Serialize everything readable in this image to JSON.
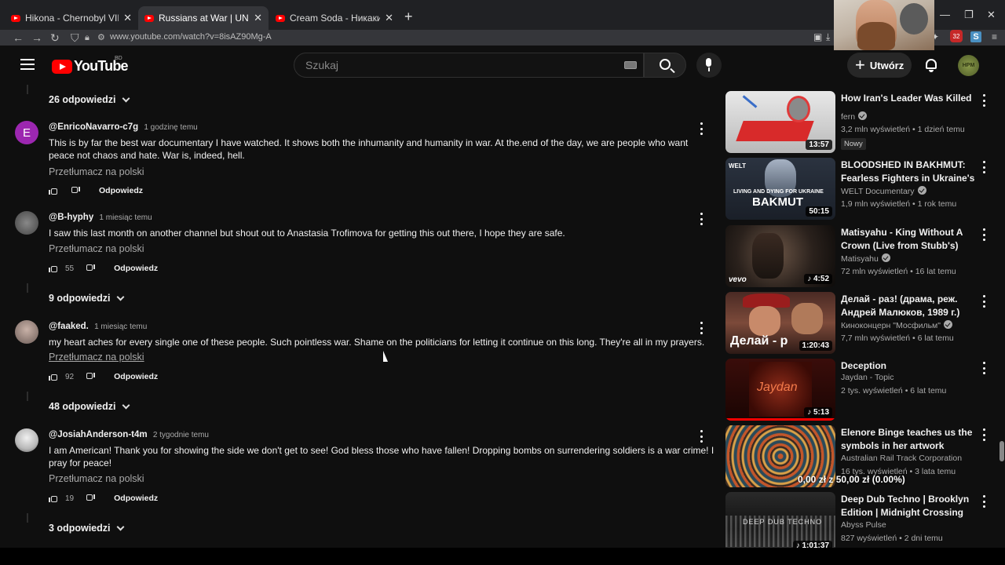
{
  "browser": {
    "tabs": [
      {
        "title": "Hikona - Chernobyl VIP - YouTube",
        "active": false
      },
      {
        "title": "Russians at War | UNCENSORED",
        "active": true
      },
      {
        "title": "Cream Soda - Никаких бол",
        "active": false
      }
    ],
    "new_tab_icon": "+",
    "url": "www.youtube.com/watch?v=8isAZ90Mg-A",
    "ext_badge": "32"
  },
  "header": {
    "logo_text": "YouTube",
    "country_code": "BD",
    "search_placeholder": "Szukaj",
    "create_label": "Utwórz",
    "avatar_text": "HPM"
  },
  "comments": {
    "top_replies": "26 odpowiedzi",
    "items": [
      {
        "author": "@EnricoNavarro-c7g",
        "time": "1 godzinę temu",
        "avatar_letter": "E",
        "avatar_color": "#9c27b0",
        "text": "This is by far the best war documentary I have watched. It shows both the inhumanity and humanity in war. At the.end of the day, we are people who want peace not chaos and hate. War is, indeed, hell.",
        "translate": "Przetłumacz na polski",
        "likes": "",
        "reply": "Odpowiedz",
        "replies": ""
      },
      {
        "author": "@B-hyphy",
        "time": "1 miesiąc temu",
        "avatar_letter": "",
        "avatar_color": "#6b6b6b",
        "text": "I saw this last month on another channel but shout out to Anastasia Trofimova for getting this out there, I hope they are safe.",
        "translate": "Przetłumacz na polski",
        "likes": "55",
        "reply": "Odpowiedz",
        "replies": "9 odpowiedzi"
      },
      {
        "author": "@faaked.",
        "time": "1 miesiąc temu",
        "avatar_letter": "",
        "avatar_color": "#9a8a86",
        "text": "my heart aches for every single one of these people. Such  pointless war. Shame on the politicians for letting it continue on this long. They're all in my prayers.",
        "translate": "Przetłumacz na polski",
        "likes": "92",
        "reply": "Odpowiedz",
        "replies": "48 odpowiedzi"
      },
      {
        "author": "@JosiahAnderson-t4m",
        "time": "2 tygodnie temu",
        "avatar_letter": "",
        "avatar_color": "#d6d6d6",
        "text": "I am American! Thank you for showing the side we don't get to see! God bless those who have fallen! Dropping bombs on surrendering soldiers is a war crime! I pray for peace!",
        "translate": "Przetłumacz na polski",
        "likes": "19",
        "reply": "Odpowiedz",
        "replies": "3 odpowiedzi"
      }
    ]
  },
  "sidebar": {
    "videos": [
      {
        "title": "How Iran's Leader Was Killed",
        "channel": "fern",
        "verified": true,
        "meta": "3,2 mln wyświetleń • 1 dzień temu",
        "duration": "13:57",
        "badge": "Nowy",
        "music": false
      },
      {
        "title": "BLOODSHED IN BAKHMUT: Fearless Fighters in Ukraine's ...",
        "channel": "WELT Documentary",
        "verified": true,
        "meta": "1,9 mln wyświetleń • 1 rok temu",
        "duration": "50:15",
        "badge": "",
        "music": false,
        "thumb_top": "WELT",
        "thumb_sub": "LIVING AND DYING FOR UKRAINE",
        "thumb_big": "BAKMUT"
      },
      {
        "title": "Matisyahu - King Without A Crown (Live from Stubb's)",
        "channel": "Matisyahu",
        "verified": true,
        "meta": "72 mln wyświetleń • 16 lat temu",
        "duration": "4:52",
        "badge": "",
        "music": true,
        "thumb_top": "vevo"
      },
      {
        "title": "Делай - раз! (драма, реж. Андрей Малюков, 1989 г.)",
        "channel": "Киноконцерн \"Мосфильм\"",
        "verified": true,
        "meta": "7,7 mln wyświetleń • 6 lat temu",
        "duration": "1:20:43",
        "badge": "",
        "music": false,
        "thumb_big": "Делай - р"
      },
      {
        "title": "Deception",
        "channel": "Jaydan - Topic",
        "verified": false,
        "meta": "2 tys. wyświetleń • 6 lat temu",
        "duration": "5:13",
        "badge": "",
        "music": true,
        "thumb_big": "Jaydan"
      },
      {
        "title": "Elenore Binge teaches us the symbols in her artwork Journe...",
        "channel": "Australian Rail Track Corporation",
        "verified": false,
        "meta": "16 tys. wyświetleń • 3 lata temu",
        "duration": "",
        "badge": "",
        "music": false
      },
      {
        "title": "Deep Dub Techno | Brooklyn Edition | Midnight Crossing",
        "channel": "Abyss Pulse",
        "verified": false,
        "meta": "827 wyświetleń • 2 dni temu",
        "duration": "1:01:37",
        "badge": "",
        "music": true,
        "thumb_big": "DEEP DUB TECHNO"
      }
    ]
  },
  "donation": "0,00 zł z 50,00 zł (0.00%)"
}
